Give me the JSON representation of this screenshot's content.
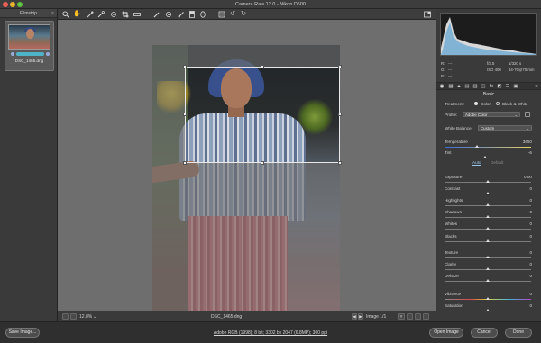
{
  "window": {
    "title": "Camera Raw 12.0  -  Nikon D600"
  },
  "filmstrip": {
    "title": "Filmstrip",
    "item": {
      "filename": "DSC_1465.dng"
    }
  },
  "toolbar": {
    "tools": [
      "zoom-icon",
      "hand-icon",
      "white-balance-icon",
      "color-sampler-icon",
      "crop-icon",
      "straighten-icon",
      "spot-removal-icon",
      "red-eye-icon",
      "adjustment-brush-icon",
      "graduated-filter-icon",
      "radial-filter-icon",
      "preferences-icon",
      "rotate-ccw-icon",
      "rotate-cw-icon"
    ]
  },
  "statusbar": {
    "zoom": "12.8%",
    "filename": "DSC_1465.dng",
    "image_counter": "Image 1/1",
    "y_label": "Y"
  },
  "histogram": {
    "r_label": "R:",
    "g_label": "G:",
    "b_label": "B:",
    "r_val": "---",
    "g_val": "---",
    "b_val": "---",
    "aperture": "f/3.5",
    "shutter": "1/320 s",
    "iso": "ISO 400",
    "focal": "34-70@70 mm"
  },
  "panel": {
    "section_title": "Basic",
    "treatment_label": "Treatment:",
    "color_label": "Color",
    "bw_label": "Black & White",
    "profile_label": "Profile:",
    "profile_value": "Adobe Color",
    "wb_label": "White Balance:",
    "wb_value": "Custom",
    "auto_label": "Auto",
    "default_label": "Default",
    "sliders": [
      {
        "label": "Temperature",
        "value": "3650",
        "pos": 0.38
      },
      {
        "label": "Tint",
        "value": "-6",
        "pos": 0.47
      },
      {
        "label": "Exposure",
        "value": "0.00",
        "pos": 0.5
      },
      {
        "label": "Contrast",
        "value": "0",
        "pos": 0.5
      },
      {
        "label": "Highlights",
        "value": "0",
        "pos": 0.5
      },
      {
        "label": "Shadows",
        "value": "0",
        "pos": 0.5
      },
      {
        "label": "Whites",
        "value": "0",
        "pos": 0.5
      },
      {
        "label": "Blacks",
        "value": "0",
        "pos": 0.5
      },
      {
        "label": "Texture",
        "value": "0",
        "pos": 0.5
      },
      {
        "label": "Clarity",
        "value": "0",
        "pos": 0.5
      },
      {
        "label": "Dehaze",
        "value": "0",
        "pos": 0.5
      },
      {
        "label": "Vibrance",
        "value": "0",
        "pos": 0.5
      },
      {
        "label": "Saturation",
        "value": "0",
        "pos": 0.5
      }
    ]
  },
  "bottombar": {
    "save_label": "Save Image...",
    "workflow_link": "Adobe RGB (1998); 8 bit; 3302 by 2047 (6.8MP); 300 ppi",
    "open_label": "Open Image",
    "cancel_label": "Cancel",
    "done_label": "Done"
  },
  "colors": {
    "accent": "#4fb3c8",
    "window_bg": "#2e2e2e",
    "canvas_bg": "#6e6e6e"
  }
}
